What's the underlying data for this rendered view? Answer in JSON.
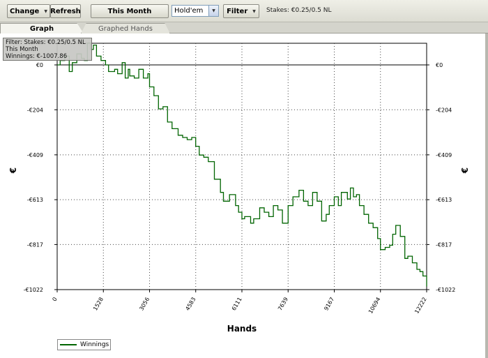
{
  "toolbar": {
    "change_label": "Change",
    "refresh_label": "Refresh",
    "period_label": "This Month",
    "game_value": "Hold'em",
    "filter_label": "Filter",
    "stakes_text": "Stakes: €0.25/0.5 NL"
  },
  "tabs": [
    {
      "label": "Graph",
      "active": true
    },
    {
      "label": "Graphed Hands",
      "active": false
    }
  ],
  "info_box": {
    "line1": "Filter: Stakes: €0.25/0.5 NL",
    "line2": "This Month",
    "line3": "Winnings: €-1007.86"
  },
  "legend": {
    "label": "Winnings"
  },
  "colors": {
    "series": "#006400",
    "grid": "#444444",
    "background": "#ffffff"
  },
  "chart_data": {
    "type": "line",
    "xlabel": "Hands",
    "ylabel": "€",
    "x_ticks": [
      "0",
      "1528",
      "3056",
      "4583",
      "6111",
      "7639",
      "9167",
      "10694",
      "12222"
    ],
    "y_ticks_left": [
      "€0",
      "-€204",
      "-€409",
      "-€613",
      "-€817",
      "-€1022"
    ],
    "y_ticks_right": [
      "€0",
      "-€204",
      "-€409",
      "-€613",
      "-€817",
      "-€1022"
    ],
    "xlim": [
      0,
      12222
    ],
    "ylim": [
      -1022,
      160
    ],
    "grid": true,
    "legend_position": "bottom-left",
    "series": [
      {
        "name": "Winnings",
        "color": "#006400",
        "x": [
          0,
          100,
          250,
          400,
          500,
          650,
          800,
          900,
          1000,
          1100,
          1200,
          1300,
          1450,
          1600,
          1700,
          1900,
          2000,
          2150,
          2250,
          2350,
          2400,
          2550,
          2700,
          2850,
          3000,
          3056,
          3200,
          3350,
          3500,
          3650,
          3800,
          4000,
          4150,
          4300,
          4450,
          4583,
          4700,
          4850,
          5000,
          5200,
          5400,
          5500,
          5700,
          5900,
          6000,
          6111,
          6200,
          6400,
          6500,
          6700,
          6850,
          7000,
          7150,
          7300,
          7450,
          7639,
          7800,
          8000,
          8150,
          8300,
          8450,
          8600,
          8750,
          8900,
          9000,
          9167,
          9300,
          9400,
          9600,
          9700,
          9800,
          9900,
          10000,
          10150,
          10300,
          10450,
          10600,
          10694,
          10850,
          11000,
          11100,
          11200,
          11350,
          11500,
          11600,
          11750,
          11900,
          12000,
          12100,
          12222
        ],
        "y": [
          0,
          20,
          40,
          -30,
          10,
          50,
          30,
          20,
          100,
          70,
          90,
          40,
          20,
          0,
          -30,
          -20,
          -40,
          10,
          -60,
          -20,
          -50,
          -60,
          -20,
          -60,
          -40,
          -100,
          -140,
          -200,
          -190,
          -260,
          -290,
          -320,
          -330,
          -340,
          -330,
          -370,
          -410,
          -420,
          -440,
          -520,
          -580,
          -620,
          -590,
          -640,
          -670,
          -700,
          -690,
          -720,
          -700,
          -650,
          -670,
          -690,
          -640,
          -660,
          -720,
          -640,
          -600,
          -570,
          -620,
          -640,
          -580,
          -620,
          -710,
          -680,
          -640,
          -600,
          -640,
          -580,
          -610,
          -560,
          -600,
          -590,
          -640,
          -680,
          -720,
          -740,
          -790,
          -840,
          -830,
          -820,
          -770,
          -730,
          -780,
          -880,
          -870,
          -900,
          -930,
          -940,
          -960,
          -1007.86
        ]
      }
    ]
  }
}
